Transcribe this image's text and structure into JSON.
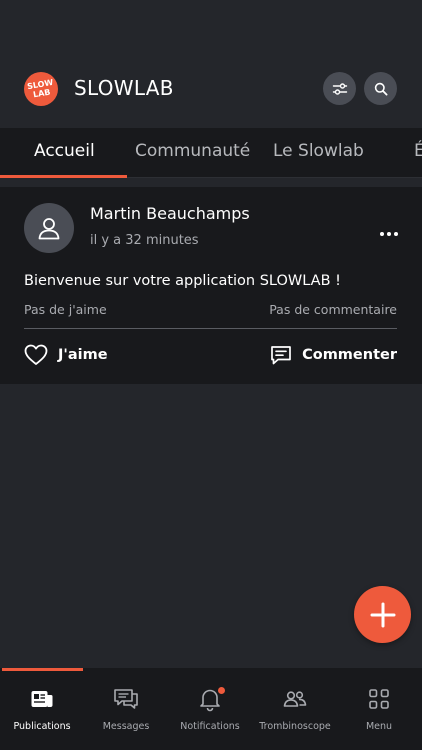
{
  "app": {
    "title": "SLOWLAB",
    "logo_text": "SLOW LAB",
    "accent_color": "#ee5a3c"
  },
  "header": {
    "filter_icon": "sliders-icon",
    "search_icon": "search-icon"
  },
  "tabs": [
    {
      "label": "Accueil",
      "active": true
    },
    {
      "label": "Communauté",
      "active": false
    },
    {
      "label": "Le Slowlab",
      "active": false
    },
    {
      "label": "É",
      "active": false
    }
  ],
  "post": {
    "author": "Martin Beauchamps",
    "time": "il y a 32 minutes",
    "text": "Bienvenue sur votre application SLOWLAB !",
    "likes_text": "Pas de j'aime",
    "comments_text": "Pas de commentaire",
    "like_label": "J'aime",
    "comment_label": "Commenter"
  },
  "bottom_nav": [
    {
      "label": "Publications",
      "icon": "newspaper-icon",
      "active": true
    },
    {
      "label": "Messages",
      "icon": "chat-bubbles-icon",
      "active": false
    },
    {
      "label": "Notifications",
      "icon": "bell-icon",
      "active": false,
      "badge": true
    },
    {
      "label": "Trombinoscope",
      "icon": "people-icon",
      "active": false
    },
    {
      "label": "Menu",
      "icon": "grid-icon",
      "active": false
    }
  ]
}
